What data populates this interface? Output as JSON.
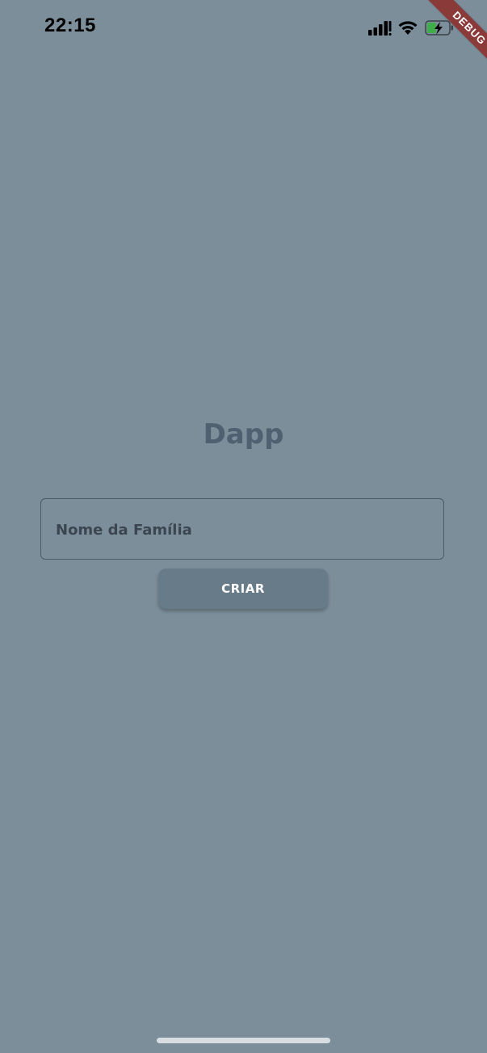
{
  "status_bar": {
    "time": "22:15",
    "icons": [
      "signal-icon",
      "wifi-icon",
      "battery-charging-icon"
    ]
  },
  "debug_banner": {
    "label": "DEBUG",
    "color": "#8b3a3a"
  },
  "main": {
    "title": "Dapp",
    "name_field": {
      "placeholder": "Nome da Família",
      "value": ""
    },
    "create_button": {
      "label": "CRIAR"
    }
  },
  "colors": {
    "background": "#7c8e9a",
    "title": "#4f6170",
    "button": "#677b88",
    "field_border": "#4a5a66"
  }
}
